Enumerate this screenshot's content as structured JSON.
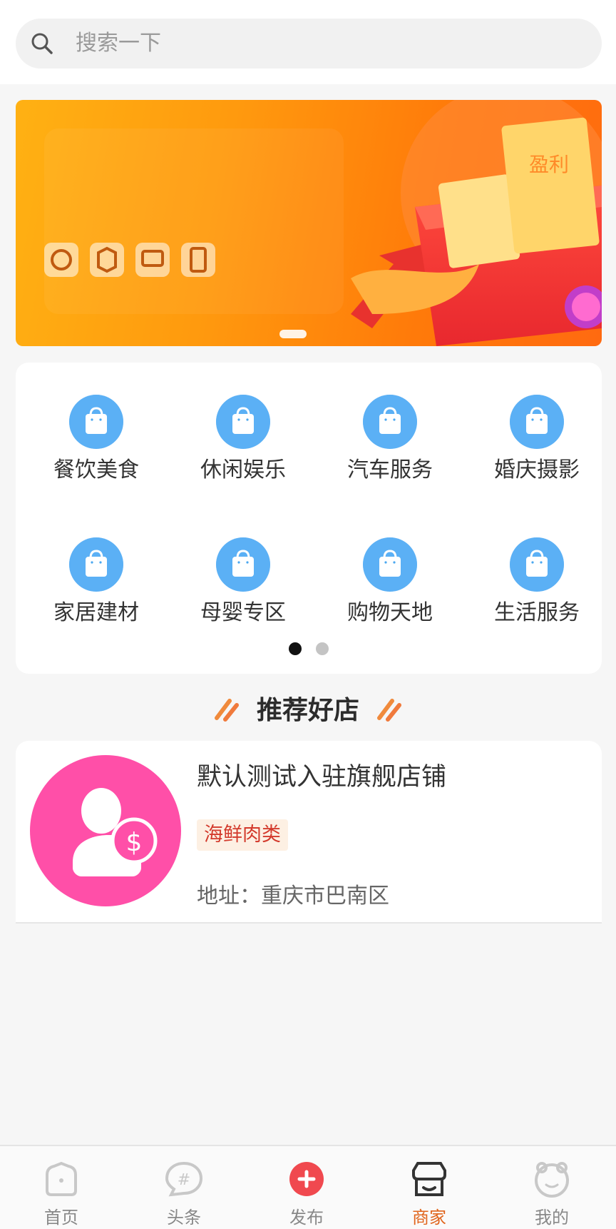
{
  "search": {
    "placeholder": "搜索一下",
    "icon": "search-icon"
  },
  "banner": {
    "art_text": "盈利",
    "active_index": 0
  },
  "categories": [
    {
      "label": "餐饮美食",
      "icon": "shopping-bag-icon"
    },
    {
      "label": "休闲娱乐",
      "icon": "shopping-bag-icon"
    },
    {
      "label": "汽车服务",
      "icon": "shopping-bag-icon"
    },
    {
      "label": "婚庆摄影",
      "icon": "shopping-bag-icon"
    },
    {
      "label": "家居建材",
      "icon": "shopping-bag-icon"
    },
    {
      "label": "母婴专区",
      "icon": "shopping-bag-icon"
    },
    {
      "label": "购物天地",
      "icon": "shopping-bag-icon"
    },
    {
      "label": "生活服务",
      "icon": "shopping-bag-icon"
    }
  ],
  "category_pager": {
    "pages": 2,
    "active": 0
  },
  "recommend": {
    "title": "推荐好店"
  },
  "shops": [
    {
      "name": "默认测试入驻旗舰店铺",
      "tag": "海鲜肉类",
      "address": "地址：重庆市巴南区"
    }
  ],
  "tabbar": [
    {
      "label": "首页",
      "icon": "home-icon",
      "active": false
    },
    {
      "label": "头条",
      "icon": "hashtag-chat-icon",
      "active": false
    },
    {
      "label": "发布",
      "icon": "plus-circle-icon",
      "active": false
    },
    {
      "label": "商家",
      "icon": "storefront-icon",
      "active": true
    },
    {
      "label": "我的",
      "icon": "profile-face-icon",
      "active": false
    }
  ],
  "colors": {
    "accent": "#e0641b",
    "category_icon": "#4aa7f0",
    "tag_text": "#d33a2c",
    "shop_logo": "#ff4fa8",
    "publish_button": "#f0494f"
  }
}
